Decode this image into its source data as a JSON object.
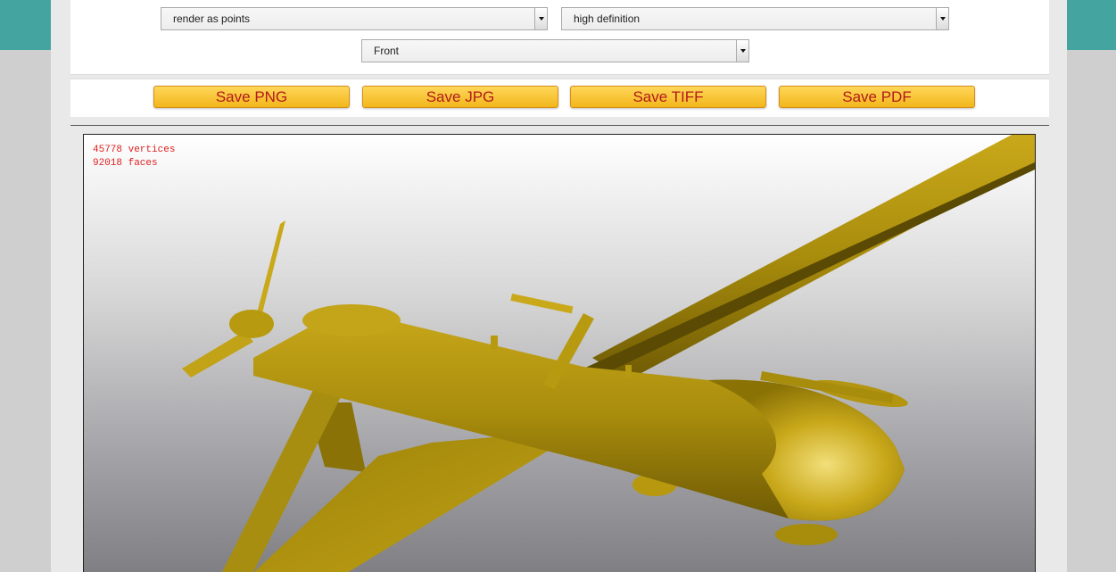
{
  "controls": {
    "render_mode": {
      "value": "render as points"
    },
    "quality": {
      "value": "high definition"
    },
    "view": {
      "value": "Front"
    }
  },
  "save_buttons": {
    "png": "Save PNG",
    "jpg": "Save JPG",
    "tiff": "Save TIFF",
    "pdf": "Save PDF"
  },
  "viewer": {
    "vertices_text": "45778 vertices",
    "faces_text": "92018 faces"
  },
  "colors": {
    "accent_teal": "#44a5a0",
    "button_gold": "#f2b61b",
    "button_text": "#b21a1a",
    "model_gold": "#b89a10",
    "stats_red": "#e02020"
  }
}
